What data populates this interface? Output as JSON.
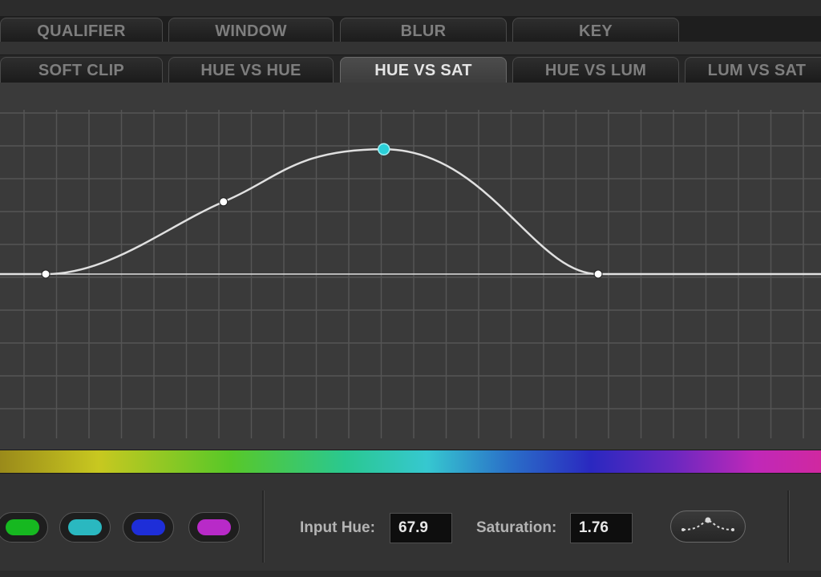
{
  "tabs_row1": [
    "QUALIFIER",
    "WINDOW",
    "BLUR",
    "KEY"
  ],
  "tabs_row2": [
    "SOFT CLIP",
    "HUE VS HUE",
    "HUE VS SAT",
    "HUE VS LUM",
    "LUM VS SAT"
  ],
  "active_tab": "HUE VS SAT",
  "curve": {
    "control_points": [
      {
        "hue": 0.0,
        "saturation": 1.0
      },
      {
        "hue": 22.4,
        "saturation": 1.44
      },
      {
        "hue": 42.6,
        "saturation": 1.76
      },
      {
        "hue": 69.6,
        "saturation": 1.0
      }
    ],
    "selected_point_index": 2
  },
  "swatches": [
    {
      "name": "green",
      "color": "#16b820"
    },
    {
      "name": "cyan",
      "color": "#2ab8c0"
    },
    {
      "name": "blue",
      "color": "#1e2ed8"
    },
    {
      "name": "magenta",
      "color": "#b82ac8"
    }
  ],
  "fields": {
    "input_hue_label": "Input Hue:",
    "input_hue_value": "67.9",
    "saturation_label": "Saturation:",
    "saturation_value": "1.76"
  },
  "colors": {
    "curve": "#e0e0e0",
    "selected_point": "#2ad0d8",
    "grid": "#555555"
  },
  "icons": {
    "curve_button": "curve-preset-icon"
  }
}
